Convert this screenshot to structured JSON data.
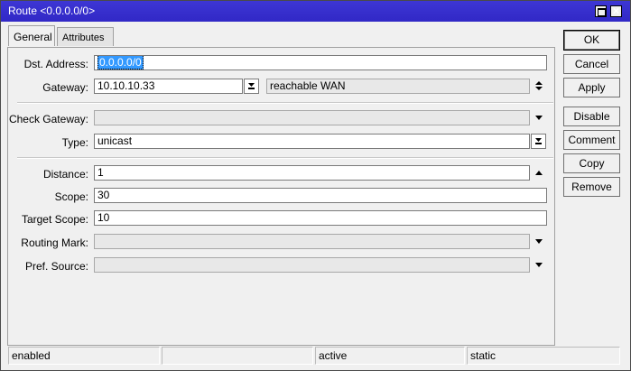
{
  "window": {
    "title": "Route <0.0.0.0/0>"
  },
  "tabs": [
    {
      "label": "General"
    },
    {
      "label": "Attributes"
    }
  ],
  "form": {
    "dst_address": {
      "label": "Dst. Address:",
      "value": "0.0.0.0/0"
    },
    "gateway": {
      "label": "Gateway:",
      "value": "10.10.10.33",
      "status": "reachable WAN"
    },
    "check_gateway": {
      "label": "Check Gateway:",
      "value": ""
    },
    "type": {
      "label": "Type:",
      "value": "unicast"
    },
    "distance": {
      "label": "Distance:",
      "value": "1"
    },
    "scope": {
      "label": "Scope:",
      "value": "30"
    },
    "target_scope": {
      "label": "Target Scope:",
      "value": "10"
    },
    "routing_mark": {
      "label": "Routing Mark:",
      "value": ""
    },
    "pref_source": {
      "label": "Pref. Source:",
      "value": ""
    }
  },
  "buttons": {
    "ok": "OK",
    "cancel": "Cancel",
    "apply": "Apply",
    "disable": "Disable",
    "comment": "Comment",
    "copy": "Copy",
    "remove": "Remove"
  },
  "statusbar": [
    "enabled",
    "",
    "active",
    "static"
  ],
  "icons": {
    "maximize": "maximize-icon",
    "close": "close-icon",
    "dropdown": "chevron-down-icon",
    "updown": "up-down-icon",
    "collapse": "triangle-up-icon"
  },
  "colors": {
    "titlebar": "#3128c6",
    "selection": "#3399ff"
  }
}
